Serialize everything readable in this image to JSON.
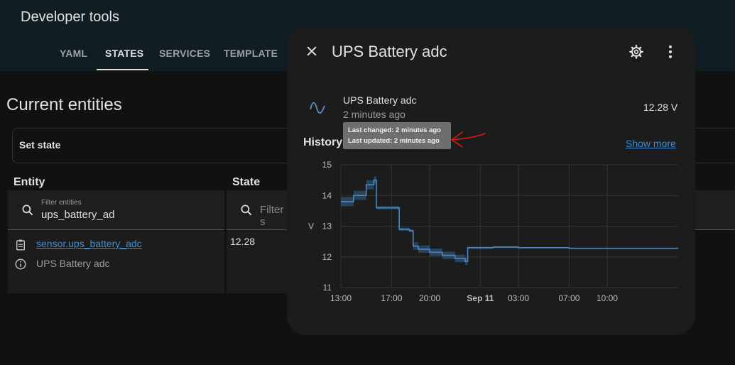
{
  "header": {
    "title": "Developer tools",
    "tabs": [
      {
        "label": "YAML"
      },
      {
        "label": "STATES",
        "active": true
      },
      {
        "label": "SERVICES"
      },
      {
        "label": "TEMPLATE"
      }
    ]
  },
  "main": {
    "title": "Current entities",
    "set_state_label": "Set state",
    "columns": {
      "entity": "Entity",
      "state": "State"
    },
    "entity_filter": {
      "label": "Filter entities",
      "value": "ups_battery_ad"
    },
    "state_filter": {
      "placeholder": "Filter s"
    },
    "row": {
      "entity_id": "sensor.ups_battery_adc",
      "friendly_name": "UPS Battery adc",
      "state": "12.28"
    }
  },
  "dialog": {
    "title": "UPS Battery adc",
    "entity_name": "UPS Battery adc",
    "last_changed_relative": "2 minutes ago",
    "state": "12.28 V",
    "history_label": "History",
    "show_more": "Show more",
    "tooltip": {
      "last_changed": "Last changed: 2 minutes ago",
      "last_updated": "Last updated: 2 minutes ago"
    }
  },
  "icons": {
    "close": "close-icon",
    "settings": "gear-icon",
    "more": "dots-vertical-icon",
    "sensor": "sine-wave-icon",
    "search": "search-icon",
    "clipboard": "clipboard-icon",
    "info": "info-icon"
  },
  "colors": {
    "accent": "#3b8fd9",
    "line": "#4a86c5",
    "band": "#2d4a66",
    "annotation": "#d9191c"
  },
  "chart_data": {
    "type": "line",
    "xlabel": "",
    "ylabel": "V",
    "ylim": [
      11,
      15
    ],
    "yticks": [
      11,
      12,
      13,
      14,
      15
    ],
    "x_hours": [
      0,
      1,
      2,
      2.6,
      2.8,
      4.2,
      4.6,
      5.4,
      5.7,
      6.1,
      7.0,
      8.0,
      9.0,
      9.8,
      10.0,
      12,
      14,
      18,
      22,
      26
    ],
    "values": [
      13.8,
      14.0,
      14.35,
      14.5,
      13.6,
      13.6,
      12.9,
      12.85,
      12.35,
      12.25,
      12.15,
      12.05,
      11.95,
      11.85,
      12.3,
      12.32,
      12.3,
      12.28,
      12.28,
      12.28
    ],
    "band": [
      0.15,
      0.15,
      0.15,
      0.12,
      0.05,
      0.05,
      0.05,
      0.05,
      0.12,
      0.12,
      0.12,
      0.12,
      0.12,
      0.12,
      0.03,
      0.03,
      0.02,
      0.02,
      0.02,
      0.02
    ],
    "x_range_hours": [
      0,
      26.6
    ],
    "xticks": [
      {
        "label": "13:00",
        "hour": 0
      },
      {
        "label": "17:00",
        "hour": 4
      },
      {
        "label": "20:00",
        "hour": 7
      },
      {
        "label": "Sep 11",
        "hour": 11,
        "bold": true
      },
      {
        "label": "03:00",
        "hour": 14
      },
      {
        "label": "07:00",
        "hour": 18
      },
      {
        "label": "10:00",
        "hour": 21
      }
    ],
    "grid": true,
    "legend": "none"
  }
}
